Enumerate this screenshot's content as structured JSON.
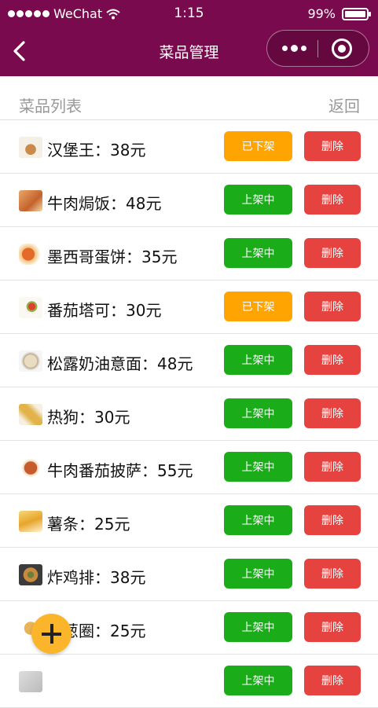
{
  "status_bar": {
    "carrier": "WeChat",
    "time": "1:15",
    "battery": "99%",
    "battery_level": 0.99
  },
  "nav": {
    "title": "菜品管理"
  },
  "sub_header": {
    "title": "菜品列表",
    "back_label": "返回"
  },
  "dishes": [
    {
      "name": "汉堡王：38元",
      "status": "已下架",
      "active": false,
      "delete": "删除"
    },
    {
      "name": "牛肉焗饭：48元",
      "status": "上架中",
      "active": true,
      "delete": "删除"
    },
    {
      "name": "墨西哥蛋饼：35元",
      "status": "上架中",
      "active": true,
      "delete": "删除"
    },
    {
      "name": "番茄塔可：30元",
      "status": "已下架",
      "active": false,
      "delete": "删除"
    },
    {
      "name": "松露奶油意面：48元",
      "status": "上架中",
      "active": true,
      "delete": "删除"
    },
    {
      "name": "热狗：30元",
      "status": "上架中",
      "active": true,
      "delete": "删除"
    },
    {
      "name": "牛肉番茄披萨：55元",
      "status": "上架中",
      "active": true,
      "delete": "删除"
    },
    {
      "name": "薯条：25元",
      "status": "上架中",
      "active": true,
      "delete": "删除"
    },
    {
      "name": "炸鸡排：38元",
      "status": "上架中",
      "active": true,
      "delete": "删除"
    },
    {
      "name": "洋葱圈：25元",
      "status": "上架中",
      "active": true,
      "delete": "删除"
    },
    {
      "name": "",
      "status": "上架中",
      "active": true,
      "delete": "删除"
    }
  ],
  "colors": {
    "nav_bg": "#7a0a4e",
    "on_sale": "#1aad19",
    "off_sale": "#ffa400",
    "delete": "#e64340",
    "fab": "#fbb52a"
  },
  "icons": {
    "back": "chevron-left-icon",
    "more": "more-dots-icon",
    "close": "target-icon",
    "add": "plus-icon"
  }
}
